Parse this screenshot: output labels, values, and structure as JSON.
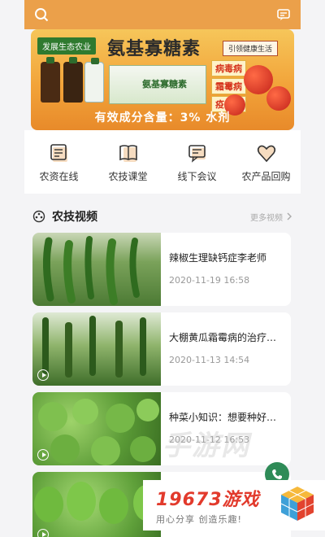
{
  "header": {
    "search_icon": "search-icon",
    "message_icon": "message-icon"
  },
  "banner": {
    "left_tag": "发展生态农业",
    "main_title": "氨基寡糖素",
    "right_tag": "引领健康生活",
    "disease_tags": [
      "病毒病",
      "霜霉病",
      "疫病"
    ],
    "product_label": "氨基寡糖素",
    "bottom_text": "有效成分含量：3%   水剂"
  },
  "quick_nav": [
    {
      "label": "农资在线",
      "icon": "farm-supplies-icon"
    },
    {
      "label": "农技课堂",
      "icon": "book-icon"
    },
    {
      "label": "线下会议",
      "icon": "meeting-icon"
    },
    {
      "label": "农产品回购",
      "icon": "heart-icon"
    }
  ],
  "videos_section": {
    "title": "农技视频",
    "more": "更多视频",
    "icon": "film-icon"
  },
  "videos": [
    {
      "title": "辣椒生理缺钙症李老师",
      "date": "2020-11-19 16:58"
    },
    {
      "title": "大棚黄瓜霜霉病的治疗…",
      "date": "2020-11-13 14:54"
    },
    {
      "title": "种菜小知识：想要种好…",
      "date": "2020-11-12 16:53"
    },
    {
      "title": "",
      "date": ""
    }
  ],
  "watermark": "手游网",
  "site": {
    "name": "19673游戏",
    "slogan": "用心分享 创造乐趣!"
  },
  "colors": {
    "accent": "#eba04a",
    "banner": "#f2a43a",
    "brand_red": "#e23a2c",
    "float": "#2e8b57"
  }
}
